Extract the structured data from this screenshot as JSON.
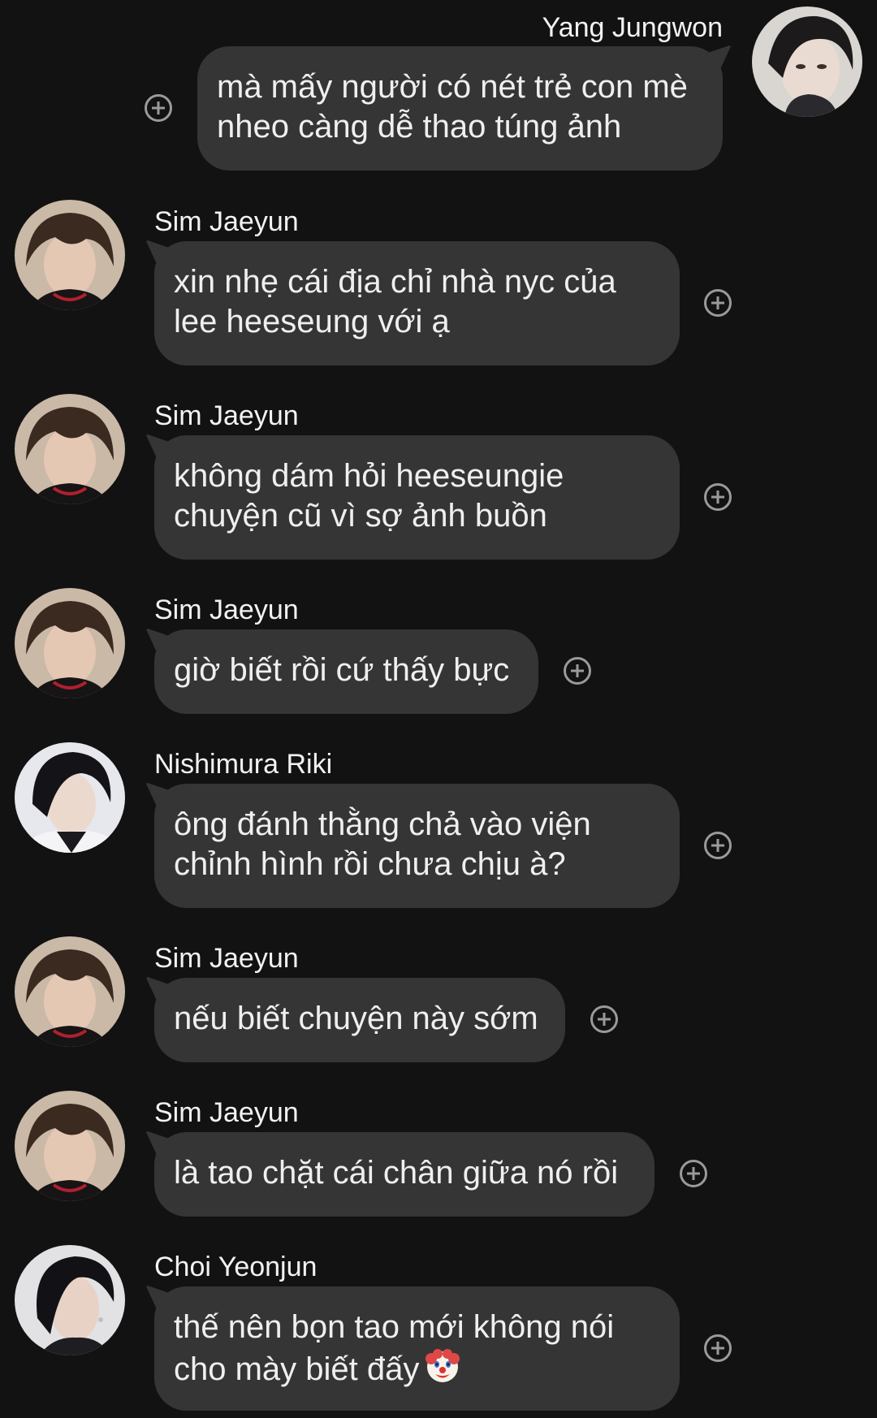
{
  "messages": [
    {
      "sender": "Yang Jungwon",
      "direction": "outgoing",
      "lines": [
        "mà mấy người có nét trẻ con mè",
        "nheo càng dễ thao túng ảnh"
      ]
    },
    {
      "sender": "Sim Jaeyun",
      "direction": "incoming",
      "lines": [
        "xin nhẹ cái địa chỉ nhà nyc của",
        "lee heeseung với ạ"
      ]
    },
    {
      "sender": "Sim Jaeyun",
      "direction": "incoming",
      "lines": [
        "không dám hỏi heeseungie",
        "chuyện cũ vì sợ ảnh buồn"
      ]
    },
    {
      "sender": "Sim Jaeyun",
      "direction": "incoming",
      "lines": [
        "giờ biết rồi cứ thấy bực"
      ]
    },
    {
      "sender": "Nishimura Riki",
      "direction": "incoming",
      "lines": [
        "ông đánh thằng chả vào viện",
        "chỉnh hình rồi chưa chịu à?"
      ]
    },
    {
      "sender": "Sim Jaeyun",
      "direction": "incoming",
      "lines": [
        "nếu biết chuyện này sớm"
      ]
    },
    {
      "sender": "Sim Jaeyun",
      "direction": "incoming",
      "lines": [
        "là tao chặt cái chân giữa nó rồi"
      ]
    },
    {
      "sender": "Choi Yeonjun",
      "direction": "incoming",
      "lines": [
        "thế nên bọn tao mới không nói",
        "cho mày biết đấy"
      ],
      "emoji": "clown-face"
    }
  ],
  "icons": {
    "react": "add-reaction-icon",
    "emoji": "clown-face-icon"
  },
  "colors": {
    "background": "#121213",
    "bubble": "#353535",
    "text": "#efefef",
    "icon": "#9a9a9a"
  }
}
